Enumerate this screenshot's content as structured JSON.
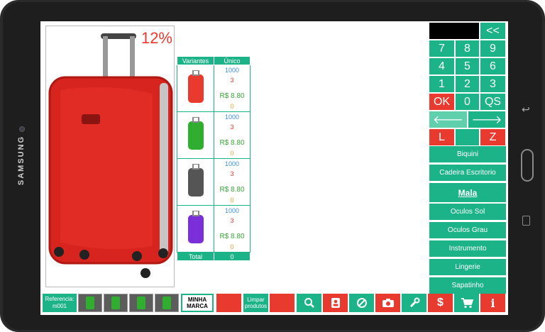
{
  "badge": {
    "discount": "12%"
  },
  "variants": {
    "header_variants": "Variantes",
    "header_unique": "Único",
    "rows": [
      {
        "color": "#e83a2e",
        "a": "1000",
        "b": "3",
        "price": "R$ 8.80",
        "d": "0"
      },
      {
        "color": "#2fae2f",
        "a": "1000",
        "b": "3",
        "price": "R$ 8.80",
        "d": "0"
      },
      {
        "color": "#555555",
        "a": "1000",
        "b": "3",
        "price": "R$ 8.80",
        "d": "0"
      },
      {
        "color": "#7a2fd9",
        "a": "1000",
        "b": "3",
        "price": "R$ 8.80",
        "d": "0"
      }
    ],
    "total_label": "Total",
    "total_value": "0"
  },
  "keypad": {
    "back": "<<",
    "k7": "7",
    "k8": "8",
    "k9": "9",
    "k4": "4",
    "k5": "5",
    "k6": "6",
    "k1": "1",
    "k2": "2",
    "k3": "3",
    "ok": "OK",
    "k0": "0",
    "qs": "QS",
    "left_arrow": "🡐",
    "right_arrow": "🡒",
    "l": "L",
    "z": "Z"
  },
  "categories": [
    "Biquini",
    "Cadeira Escritorio",
    "Mala",
    "Oculos Sol",
    "Oculos Grau",
    "Instrumento",
    "Lingerie",
    "Sapatinho"
  ],
  "bottom": {
    "reference": "Referencia:\nm001",
    "brand": "MINHA\nMARCA",
    "clear": "Limpar\nprodutos"
  }
}
